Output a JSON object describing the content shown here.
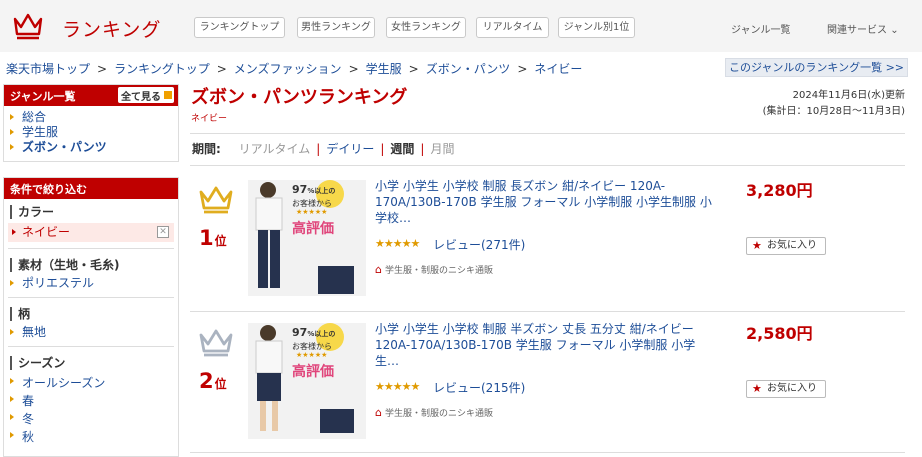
{
  "header": {
    "logo": "ランキング",
    "tabs": [
      "ランキングトップ",
      "男性ランキング",
      "女性ランキング",
      "リアルタイム",
      "ジャンル別1位"
    ],
    "genre_list": "ジャンル一覧",
    "related": "関連サービス"
  },
  "breadcrumb": [
    "楽天市場トップ",
    "ランキングトップ",
    "メンズファッション",
    "学生服",
    "ズボン・パンツ",
    "ネイビー"
  ],
  "genre_ranking_link": "このジャンルのランキング一覧 >>",
  "sidebar": {
    "genre_title": "ジャンル一覧",
    "show_all": "全て見る",
    "genres": [
      "総合",
      "学生服",
      "ズボン・パンツ"
    ],
    "filter_title": "条件で絞り込む",
    "color_label": "カラー",
    "color_selected": "ネイビー",
    "material_label": "素材（生地・毛糸)",
    "materials": [
      "ポリエステル"
    ],
    "pattern_label": "柄",
    "patterns": [
      "無地"
    ],
    "season_label": "シーズン",
    "seasons": [
      "オールシーズン",
      "春",
      "冬",
      "秋"
    ]
  },
  "main": {
    "title": "ズボン・パンツランキング",
    "subtitle": "ネイビー",
    "updated": "2024年11月6日(水)更新",
    "period_range": "(集計日：10月28日～11月3日)",
    "period_label": "期間:",
    "periods": [
      "リアルタイム",
      "デイリー",
      "週間",
      "月間"
    ]
  },
  "items": [
    {
      "rank": "1",
      "rank_suffix": "位",
      "title": "小学 小学生 小学校 制服 長ズボン 紺/ネイビー 120A-170A/130B-170B 学生服 フォーマル 小学制服 小学生制服 小学校…",
      "stars": "★★★★★",
      "reviews": "レビュー(271件)",
      "shop": "学生服・制服のニシキ通販",
      "price": "3,280円",
      "fav": "お気に入り",
      "badge_big": "97",
      "badge_small": "%以上の",
      "badge_line2": "お客様から",
      "badge_word": "高評価"
    },
    {
      "rank": "2",
      "rank_suffix": "位",
      "title": "小学 小学生 小学校 制服 半ズボン 丈長 五分丈 紺/ネイビー 120A-170A/130B-170B 学生服 フォーマル 小学制服 小学生…",
      "stars": "★★★★★",
      "reviews": "レビュー(215件)",
      "shop": "学生服・制服のニシキ通販",
      "price": "2,580円",
      "fav": "お気に入り",
      "badge_big": "97",
      "badge_small": "%以上の",
      "badge_line2": "お客様から",
      "badge_word": "高評価"
    }
  ],
  "colors": {
    "accent": "#bf0000",
    "link": "#1d4d97",
    "gold": "#e09a00"
  }
}
